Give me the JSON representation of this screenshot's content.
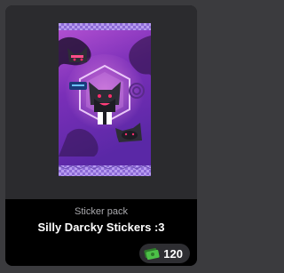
{
  "card": {
    "type_label": "Sticker pack",
    "title": "Silly Darcky Stickers :3",
    "price": "120"
  },
  "icons": {
    "currency": "money-icon"
  },
  "colors": {
    "card_bg": "#1d1d20",
    "info_bg": "#000000",
    "pack_purple": "#6a2fb0",
    "pack_pink": "#e04fb8",
    "money_green": "#3fa83a"
  }
}
